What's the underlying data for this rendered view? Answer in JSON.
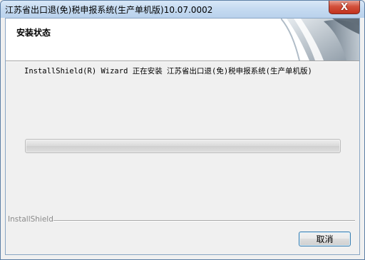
{
  "window": {
    "title": "江苏省出口退(免)税申报系统(生产单机版)10.07.0002",
    "close_glyph": "X"
  },
  "header": {
    "title": "安装状态"
  },
  "body": {
    "status_text": "InstallShield(R) Wizard 正在安装 江苏省出口退(免)税申报系统(生产单机版)",
    "progress": 0
  },
  "footer": {
    "brand": "InstallShield",
    "cancel_label": "取消"
  },
  "colors": {
    "title_bar": "#c6dbf1",
    "close_button": "#d2503b",
    "button_border": "#3c7fb1"
  }
}
